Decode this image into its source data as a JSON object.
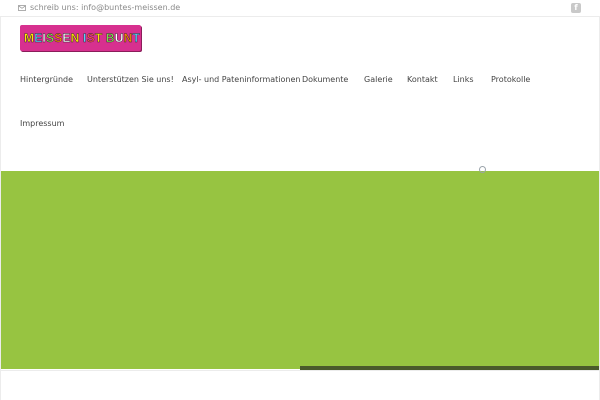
{
  "topbar": {
    "email_text": "schreib uns: info@buntes-meissen.de",
    "facebook_glyph": "f"
  },
  "logo": {
    "letters": [
      {
        "ch": "M",
        "color": "#ffe600"
      },
      {
        "ch": "E",
        "color": "#5ad0ff"
      },
      {
        "ch": "I",
        "color": "#ffffff"
      },
      {
        "ch": "S",
        "color": "#7ee04a"
      },
      {
        "ch": "S",
        "color": "#ff8a00"
      },
      {
        "ch": "E",
        "color": "#ffffff"
      },
      {
        "ch": "N",
        "color": "#ffe600"
      },
      {
        "ch": " ",
        "color": "#ffffff"
      },
      {
        "ch": "I",
        "color": "#5ad0ff"
      },
      {
        "ch": "S",
        "color": "#ff4d4d"
      },
      {
        "ch": "T",
        "color": "#ffe600"
      },
      {
        "ch": " ",
        "color": "#ffffff"
      },
      {
        "ch": "B",
        "color": "#7ee04a"
      },
      {
        "ch": "U",
        "color": "#ffffff"
      },
      {
        "ch": "N",
        "color": "#ff8a00"
      },
      {
        "ch": "T",
        "color": "#5ad0ff"
      }
    ]
  },
  "nav": {
    "items": [
      {
        "label": "Hintergründe"
      },
      {
        "label": "Unterstützen Sie uns!"
      },
      {
        "label": "Asyl- und Pateninformationen"
      },
      {
        "label": "Dokumente"
      },
      {
        "label": "Galerie"
      },
      {
        "label": "Kontakt"
      },
      {
        "label": "Links"
      },
      {
        "label": "Protokolle"
      },
      {
        "label": "Impressum"
      }
    ]
  },
  "colors": {
    "hero_green": "#97c441",
    "hero_bar": "#4a5a2b",
    "logo_bg": "#d7308f"
  }
}
